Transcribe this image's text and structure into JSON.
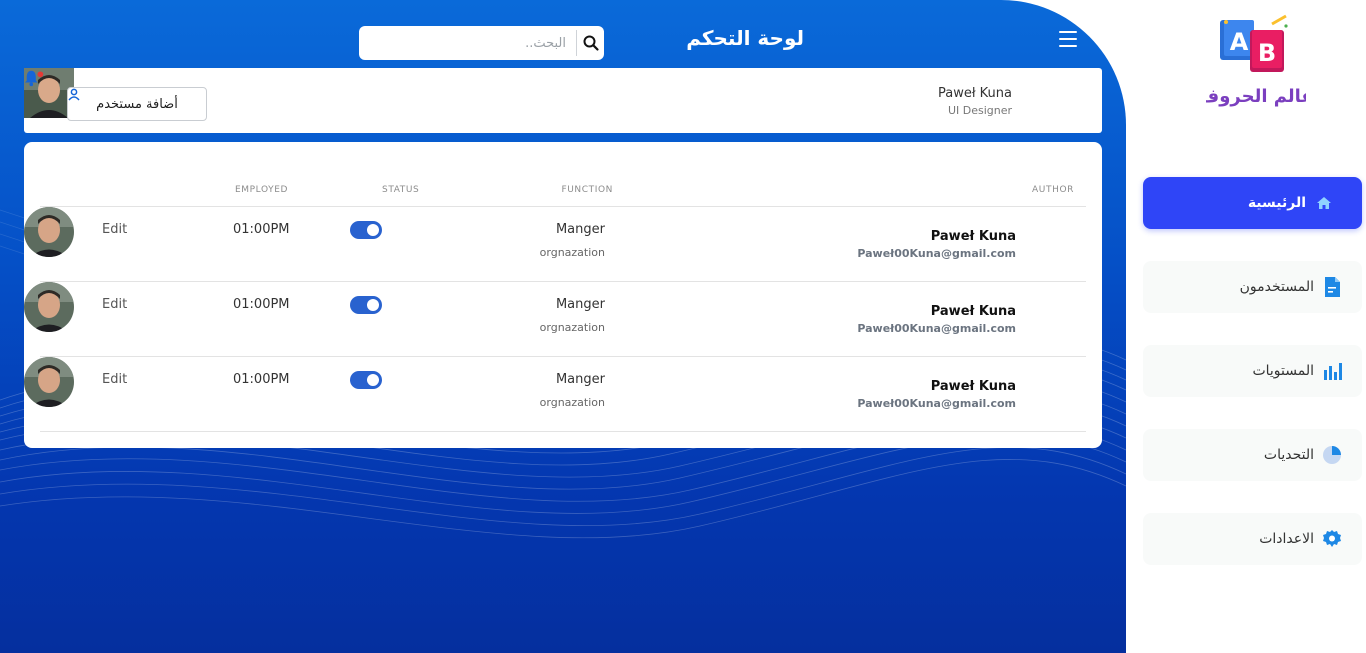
{
  "header": {
    "title": "لوحة التحكم"
  },
  "search": {
    "placeholder": "البحث.."
  },
  "user": {
    "name": "Paweł Kuna",
    "role": "UI Designer"
  },
  "actions": {
    "add_user_label": "أضافة مستخدم"
  },
  "table": {
    "columns": [
      "AUTHOR",
      "FUNCTION",
      "STATUS",
      "EMPLOYED",
      ""
    ],
    "rows": [
      {
        "name": "Paweł Kuna",
        "email": "Paweł00Kuna@gmail.com",
        "function": "Manger",
        "org": "orgnazation",
        "status_on": true,
        "employed": "01:00PM",
        "action": "Edit"
      },
      {
        "name": "Paweł Kuna",
        "email": "Paweł00Kuna@gmail.com",
        "function": "Manger",
        "org": "orgnazation",
        "status_on": true,
        "employed": "01:00PM",
        "action": "Edit"
      },
      {
        "name": "Paweł Kuna",
        "email": "Paweł00Kuna@gmail.com",
        "function": "Manger",
        "org": "orgnazation",
        "status_on": true,
        "employed": "01:00PM",
        "action": "Edit"
      }
    ]
  },
  "sidebar": {
    "logo_text": "عالم الحروف",
    "logo_letters": [
      "A",
      "B"
    ],
    "items": [
      {
        "label": "الرئيسية",
        "icon": "home-icon",
        "active": true
      },
      {
        "label": "المستخدمون",
        "icon": "document-icon",
        "active": false
      },
      {
        "label": "المستويات",
        "icon": "bar-chart-icon",
        "active": false
      },
      {
        "label": "التحديات",
        "icon": "pie-chart-icon",
        "active": false
      },
      {
        "label": "الاعدادات",
        "icon": "gear-icon",
        "active": false
      }
    ]
  },
  "colors": {
    "primary": "#2f45f7",
    "accent": "#0a6ad9",
    "toggle": "#2962cf",
    "notification_dot": "#e53935"
  }
}
